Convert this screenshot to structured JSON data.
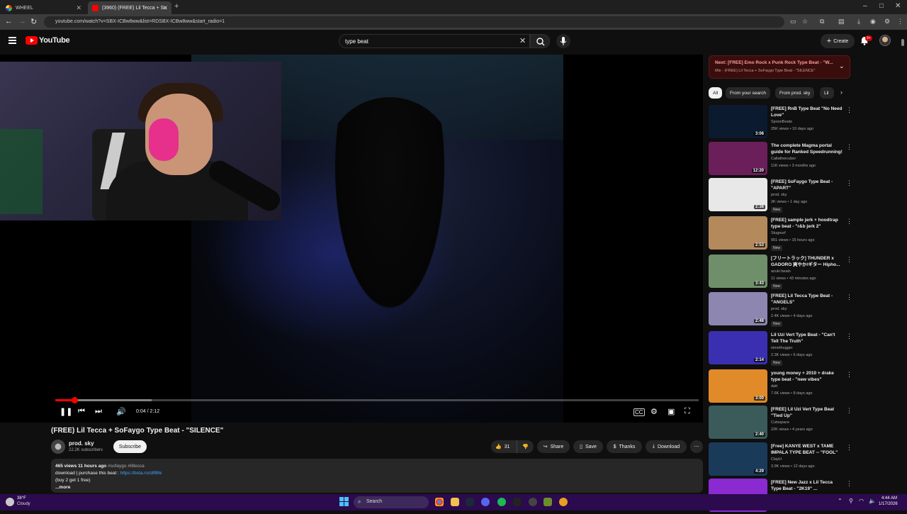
{
  "browser": {
    "tabs": [
      {
        "title": "WHEEL"
      },
      {
        "title": "(3960) (FREE) Lil Tecca + So"
      }
    ],
    "url": "youtube.com/watch?v=SBX-ICBw8ww&list=RDSBX-ICBw8ww&start_radio=1"
  },
  "header": {
    "logo_text": "YouTube",
    "search_value": "type beat",
    "create_label": "Create",
    "notif_badge": "9+"
  },
  "player": {
    "timecode": "0:04 / 2:12",
    "progress_played": 0.03,
    "progress_buffered": 0.15
  },
  "video": {
    "title": "(FREE) Lil Tecca + SoFaygo Type Beat - \"SILENCE\"",
    "channel": "prod. sky",
    "subscribers": "22.2K subscribers",
    "subscribe_label": "Subscribe",
    "likes": "31",
    "share_label": "Share",
    "save_label": "Save",
    "thanks_label": "Thanks",
    "download_label": "Download",
    "description": {
      "stats": "465 views  11 hours ago",
      "tags": "#sofaygo #liltecca",
      "line1": "download | purchase this beat : ",
      "link": "https://bsta.rs/c8f6fe",
      "line2": "(buy 2 get 1 free)",
      "more": "...more"
    }
  },
  "sidebar": {
    "next": {
      "title": "Next: [FREE] Emo Rock x Punk Rock Type Beat - \"W...",
      "subtitle": "Mix - (FREE) Lil Tecca + SoFaygo Type Beat - \"SILENCE\""
    },
    "chips": [
      "All",
      "From your search",
      "From prod. sky",
      "Lil"
    ],
    "recs": [
      {
        "title": "[FREE] RnB Type Beat \"No Need Love\"",
        "channel": "SpoonBeats",
        "meta": "25K views • 10 days ago",
        "duration": "3:06",
        "new": "",
        "thumb": "#0b1a2e"
      },
      {
        "title": "The complete Magma portal guide for Ranked Speedrunning!",
        "channel": "Callatheicuber",
        "meta": "11K views • 3 months ago",
        "duration": "12:20",
        "new": "",
        "thumb": "#6a1f5a"
      },
      {
        "title": "[FREE] SoFaygo Type Beat - \"APART\"",
        "channel": "prod. sky",
        "meta": "2K views • 1 day ago",
        "duration": "2:38",
        "new": "New",
        "thumb": "#e8e8e8"
      },
      {
        "title": "[FREE] sample jerk + hoodtrap type beat - \"r&b jerk 2\"",
        "channel": "Stugeurf",
        "meta": "901 views • 15 hours ago",
        "duration": "2:53",
        "new": "New",
        "thumb": "#b48a5c"
      },
      {
        "title": "[フリートラック] THUNDER x GADORO 爽やか/ギター Hipho...",
        "channel": "azuki beats",
        "meta": "11 views • 43 minutes ago",
        "duration": "3:43",
        "new": "New",
        "thumb": "#6f8f6a"
      },
      {
        "title": "[FREE] Lil Tecca Type Beat - \"ANGELS\"",
        "channel": "prod. sky",
        "meta": "2.4K views • 4 days ago",
        "duration": "2:48",
        "new": "New",
        "thumb": "#8c86b0"
      },
      {
        "title": "Lil Uzi Vert Type Beat - \"Can't Tell The Truth\"",
        "channel": "nimethugger",
        "meta": "2.3K views • 6 days ago",
        "duration": "2:14",
        "new": "New",
        "thumb": "#3a2fb0"
      },
      {
        "title": "young money + 2010 + drake type beat - \"new vibes\"",
        "channel": "datt",
        "meta": "7.6K views • 8 days ago",
        "duration": "3:00",
        "new": "",
        "thumb": "#e08a2a"
      },
      {
        "title": "[FREE] Lil Uzi Vert Type Beat \"Tied Up\"",
        "channel": "Cutsspace",
        "meta": "22K views • 4 years ago",
        "duration": "2:40",
        "new": "",
        "thumb": "#3b5a5a"
      },
      {
        "title": "[Free] KANYE WEST x TAME IMPALA TYPE BEAT -- \"FOOL\"",
        "channel": "ClayH",
        "meta": "3.9K views • 12 days ago",
        "duration": "4:29",
        "new": "",
        "thumb": "#1a3a5a"
      },
      {
        "title": "[FREE] New Jazz x Lil Tecca Type Beat - \"2K19\" ...",
        "channel": "",
        "meta": "",
        "duration": "",
        "new": "",
        "thumb": "#8a2ad0"
      }
    ]
  },
  "taskbar": {
    "temp": "38°F",
    "weather": "Cloudy",
    "search_label": "Search",
    "time": "4:44 AM",
    "date": "1/17/2026"
  }
}
